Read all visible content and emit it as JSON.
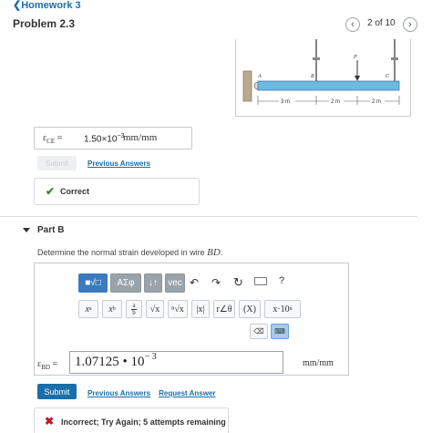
{
  "header": {
    "back_label": "Homework 3",
    "problem_title": "Problem 2.3",
    "counter": "2 of 10"
  },
  "figure": {
    "labels": {
      "A": "A",
      "B": "B",
      "C": "C",
      "P": "P"
    },
    "dims": [
      "3 m",
      "2 m",
      "2 m"
    ]
  },
  "part_a": {
    "symbol": "ε",
    "subscript": "CE",
    "equals": "=",
    "value_mantissa": "1.50×10",
    "value_exponent": "−3",
    "unit": "mm/mm",
    "submit_label": "Submit",
    "previous_answers_label": "Previous Answers",
    "feedback_label": "Correct",
    "colors": {
      "correct": "#3a8a2e"
    }
  },
  "part_b": {
    "title": "Part B",
    "question_prefix": "Determine the normal strain developed in wire ",
    "question_var": "BD",
    "question_suffix": ".",
    "toolbar": {
      "templates_label": "■√□",
      "greek_label": "ΑΣφ",
      "arrows_label": "↓↑",
      "vec_label": "vec",
      "help_label": "?"
    },
    "symbols": [
      "x",
      "a",
      "x",
      "b",
      "a",
      "b",
      "√x",
      "ⁿ√x",
      "|x|",
      "r∠θ",
      "(X)",
      "x·10",
      "n"
    ],
    "answer_symbol": "ε",
    "answer_subscript": "BD",
    "equals": "=",
    "answer_mantissa": "1.07125 • 10",
    "answer_exponent": "− 3",
    "unit": "mm/mm",
    "submit_label": "Submit",
    "previous_answers_label": "Previous Answers",
    "request_answer_label": "Request Answer",
    "feedback_label": "Incorrect; Try Again; 5 attempts remaining",
    "colors": {
      "incorrect": "#c8102e",
      "accent": "#1a6fa8"
    }
  }
}
